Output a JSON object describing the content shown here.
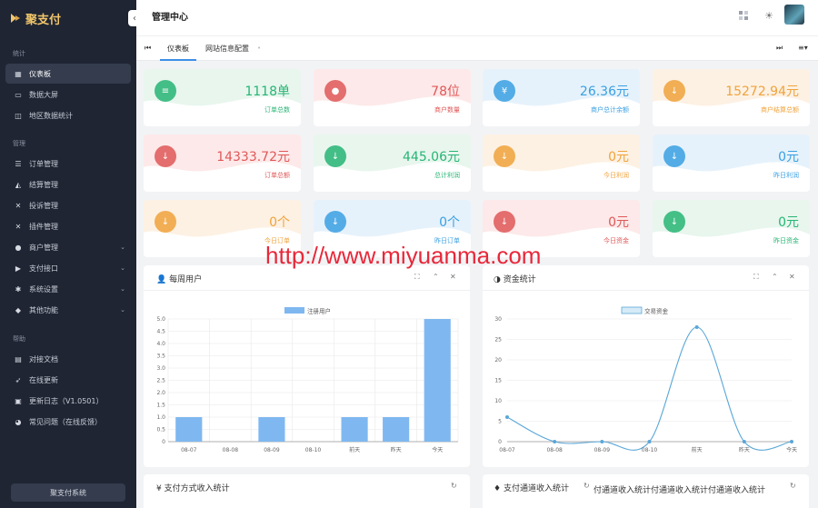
{
  "app": {
    "brand": "聚支付",
    "page_title": "管理中心",
    "watermark": "http://www.miyuanma.com"
  },
  "sidebar": {
    "section_stats": "统计",
    "section_manage": "管理",
    "section_help": "帮助",
    "stats_items": [
      {
        "label": "仪表板",
        "icon": "dashboard-icon"
      },
      {
        "label": "数据大屏",
        "icon": "monitor-icon"
      },
      {
        "label": "地区数据统计",
        "icon": "map-icon"
      }
    ],
    "manage_items": [
      {
        "label": "订单管理",
        "icon": "list-icon"
      },
      {
        "label": "结算管理",
        "icon": "settle-icon"
      },
      {
        "label": "投诉管理",
        "icon": "tools-icon"
      },
      {
        "label": "插件管理",
        "icon": "plugin-icon"
      },
      {
        "label": "商户管理",
        "icon": "user-icon"
      },
      {
        "label": "支付接口",
        "icon": "pay-icon"
      },
      {
        "label": "系统设置",
        "icon": "gear-icon"
      },
      {
        "label": "其他功能",
        "icon": "layers-icon"
      }
    ],
    "help_items": [
      {
        "label": "对接文档",
        "icon": "doc-icon"
      },
      {
        "label": "在线更新",
        "icon": "rocket-icon"
      },
      {
        "label": "更新日志（V1.0501）",
        "icon": "log-icon"
      },
      {
        "label": "常见问题（在线反馈）",
        "icon": "pie-icon"
      }
    ],
    "footer": "聚支付系统"
  },
  "tabs": [
    {
      "label": "仪表板",
      "active": true
    },
    {
      "label": "网站信息配置",
      "active": false
    }
  ],
  "stats": [
    {
      "value": "1118单",
      "label": "订单总数",
      "icon": "list-icon",
      "color": "#27b574",
      "bg": "#e8f6ee"
    },
    {
      "value": "78位",
      "label": "商户数量",
      "icon": "user-icon",
      "color": "#e05858",
      "bg": "#fde9e9"
    },
    {
      "value": "26.36元",
      "label": "商户总计余额",
      "icon": "yen-icon",
      "color": "#3aa0e2",
      "bg": "#e6f2fb"
    },
    {
      "value": "15272.94元",
      "label": "商户结算总额",
      "icon": "arrow-down-icon",
      "color": "#f0a33c",
      "bg": "#fdf1e3"
    },
    {
      "value": "14333.72元",
      "label": "订单总额",
      "icon": "arrow-down-icon",
      "color": "#e05858",
      "bg": "#fde9e9"
    },
    {
      "value": "445.06元",
      "label": "总计利润",
      "icon": "arrow-down-icon",
      "color": "#27b574",
      "bg": "#e8f6ee"
    },
    {
      "value": "0元",
      "label": "今日利润",
      "icon": "arrow-down-icon",
      "color": "#f0a33c",
      "bg": "#fdf1e3"
    },
    {
      "value": "0元",
      "label": "昨日利润",
      "icon": "arrow-down-icon",
      "color": "#3aa0e2",
      "bg": "#e6f2fb"
    },
    {
      "value": "0个",
      "label": "今日订单",
      "icon": "arrow-down-icon",
      "color": "#f0a33c",
      "bg": "#fdf1e3"
    },
    {
      "value": "0个",
      "label": "昨日订单",
      "icon": "arrow-down-icon",
      "color": "#3aa0e2",
      "bg": "#e6f2fb"
    },
    {
      "value": "0元",
      "label": "今日资金",
      "icon": "arrow-down-icon",
      "color": "#e05858",
      "bg": "#fde9e9"
    },
    {
      "value": "0元",
      "label": "昨日资金",
      "icon": "arrow-down-icon",
      "color": "#27b574",
      "bg": "#e8f6ee"
    }
  ],
  "panels": {
    "weekly_users": {
      "title": "每周用户"
    },
    "funds": {
      "title": "资金统计"
    },
    "pay_method_income": {
      "title": "支付方式收入统计"
    },
    "channel_income": {
      "title": "支付通道收入统计",
      "overlap_text": "付通道收入统计付通道收入统计付通道收入统计"
    }
  },
  "chart_data": [
    {
      "type": "bar",
      "title": "",
      "categories": [
        "08-07",
        "08-08",
        "08-09",
        "08-10",
        "前天",
        "昨天",
        "今天"
      ],
      "series": [
        {
          "name": "注册用户",
          "values": [
            1,
            0,
            1,
            0,
            1,
            1,
            5
          ]
        }
      ],
      "ylim": [
        0,
        5
      ],
      "yticks": [
        "0",
        "0.5",
        "1.0",
        "1.5",
        "2.0",
        "2.5",
        "3.0",
        "3.5",
        "4.0",
        "4.5",
        "5.0"
      ],
      "grid": true,
      "legend": "top-center",
      "color": "#7fb8f0"
    },
    {
      "type": "line",
      "title": "",
      "categories": [
        "08-07",
        "08-08",
        "08-09",
        "08-10",
        "前天",
        "昨天",
        "今天"
      ],
      "series": [
        {
          "name": "交易资金",
          "values": [
            6,
            0,
            0,
            0,
            28,
            0,
            0
          ]
        }
      ],
      "ylim": [
        0,
        30
      ],
      "yticks": [
        "0",
        "5",
        "10",
        "15",
        "20",
        "25",
        "30"
      ],
      "grid": true,
      "legend": "top-center",
      "color": "#5aa7d8"
    }
  ]
}
